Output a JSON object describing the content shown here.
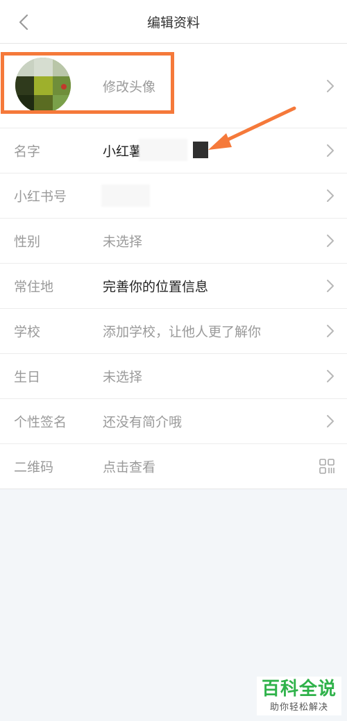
{
  "header": {
    "title": "编辑资料"
  },
  "avatar_row": {
    "action_label": "修改头像"
  },
  "rows": [
    {
      "label": "名字",
      "value": "小红薯",
      "style": "filled"
    },
    {
      "label": "小红书号",
      "value": "",
      "style": "placeholder"
    },
    {
      "label": "性别",
      "value": "未选择",
      "style": "placeholder"
    },
    {
      "label": "常住地",
      "value": "完善你的位置信息",
      "style": "filled"
    },
    {
      "label": "学校",
      "value": "添加学校，让他人更了解你",
      "style": "placeholder"
    },
    {
      "label": "生日",
      "value": "未选择",
      "style": "placeholder"
    },
    {
      "label": "个性签名",
      "value": "还没有简介哦",
      "style": "placeholder"
    },
    {
      "label": "二维码",
      "value": "点击查看",
      "style": "placeholder"
    }
  ],
  "colors": {
    "annotation": "#f5793a",
    "watermark_green": "#2fb24a"
  },
  "watermark": {
    "main": "百科全说",
    "sub": "助你轻松解决"
  }
}
